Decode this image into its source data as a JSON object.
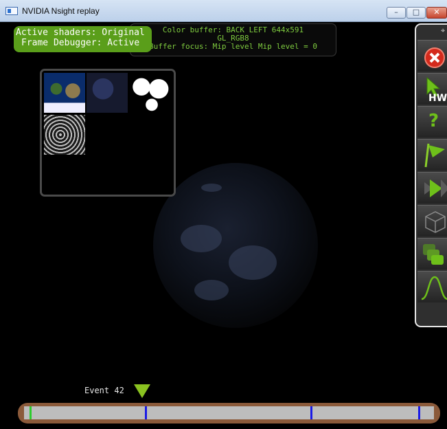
{
  "window": {
    "title": "NVIDIA Nsight replay",
    "controls": {
      "minimize": "–",
      "maximize": "□",
      "close": "✕"
    }
  },
  "overlay": {
    "line1": "Active shaders: Original",
    "line2": "Frame Debugger: Active"
  },
  "info": {
    "line1": "Color buffer: BACK LEFT 644x591",
    "line2": "GL_RGB8",
    "line3": "Buffer focus: Mip level Mip level = 0"
  },
  "toolbar": {
    "pin": "⌖",
    "items": [
      {
        "name": "close-tool-icon"
      },
      {
        "name": "hw-cursor-icon",
        "label": "HW"
      },
      {
        "name": "help-icon",
        "label": "?"
      },
      {
        "name": "flag-icon"
      },
      {
        "name": "play-frame-icon"
      },
      {
        "name": "wireframe-cube-icon"
      },
      {
        "name": "layers-icon"
      },
      {
        "name": "curve-icon"
      }
    ],
    "accent": "#6ec01a"
  },
  "timeline": {
    "event_label": "Event 42",
    "ticks": [
      {
        "pos": 0.014,
        "color": "#2ecc2e"
      },
      {
        "pos": 0.295,
        "color": "#1a1ae6"
      },
      {
        "pos": 0.698,
        "color": "#1a1ae6"
      },
      {
        "pos": 0.962,
        "color": "#1a1ae6"
      }
    ]
  }
}
